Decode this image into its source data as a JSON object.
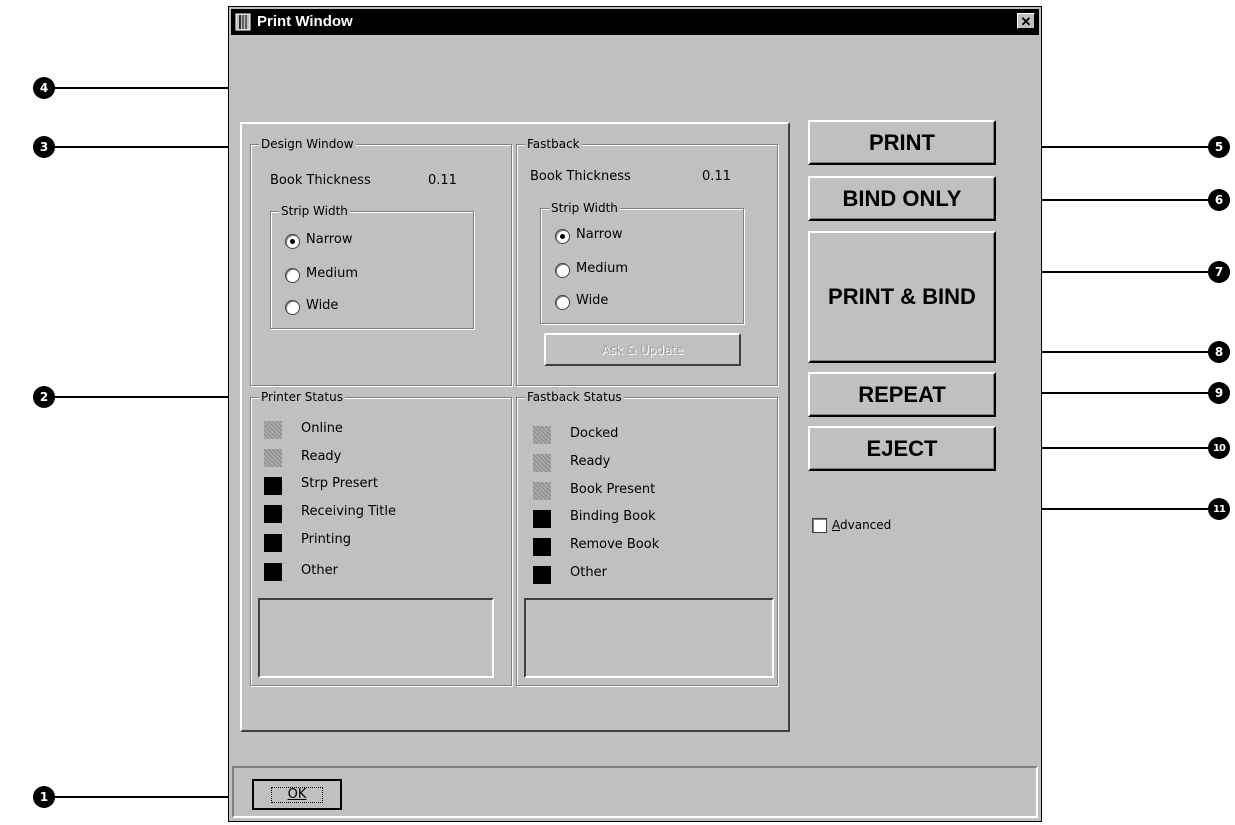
{
  "window": {
    "title": "Print Window",
    "close_label": "✕"
  },
  "design_window": {
    "title": "Design Window",
    "thickness_label": "Book Thickness",
    "thickness_value": "0.11",
    "strip_width_title": "Strip Width",
    "options": [
      "Narrow",
      "Medium",
      "Wide"
    ],
    "selected": "Narrow"
  },
  "fastback": {
    "title": "Fastback",
    "thickness_label": "Book Thickness",
    "thickness_value": "0.11",
    "strip_width_title": "Strip Width",
    "options": [
      "Narrow",
      "Medium",
      "Wide"
    ],
    "selected": "Narrow",
    "ask_update_label": "Ask & Update"
  },
  "printer_status": {
    "title": "Printer Status",
    "items": [
      {
        "label": "Online",
        "state": "on"
      },
      {
        "label": "Ready",
        "state": "on"
      },
      {
        "label": "Strp Presert",
        "state": "off"
      },
      {
        "label": "Receiving Title",
        "state": "off"
      },
      {
        "label": "Printing",
        "state": "off"
      },
      {
        "label": "Other",
        "state": "off"
      }
    ],
    "message": ""
  },
  "fastback_status": {
    "title": "Fastback Status",
    "items": [
      {
        "label": "Docked",
        "state": "on"
      },
      {
        "label": "Ready",
        "state": "on"
      },
      {
        "label": "Book Present",
        "state": "on"
      },
      {
        "label": "Binding Book",
        "state": "off"
      },
      {
        "label": "Remove Book",
        "state": "off"
      },
      {
        "label": "Other",
        "state": "off"
      }
    ],
    "message": ""
  },
  "buttons": {
    "print": "PRINT",
    "bind_only": "BIND ONLY",
    "print_bind": "PRINT & BIND",
    "repeat": "REPEAT",
    "eject": "EJECT",
    "ok": "OK"
  },
  "advanced": {
    "label": "Advanced",
    "checked": false
  },
  "callouts": [
    "1",
    "2",
    "3",
    "4",
    "5",
    "6",
    "7",
    "8",
    "9",
    "10",
    "11"
  ],
  "colors": {
    "face": "#c0c0c0",
    "titlebar": "#000000",
    "led_on": "#a8a8a8",
    "led_off": "#000000"
  }
}
